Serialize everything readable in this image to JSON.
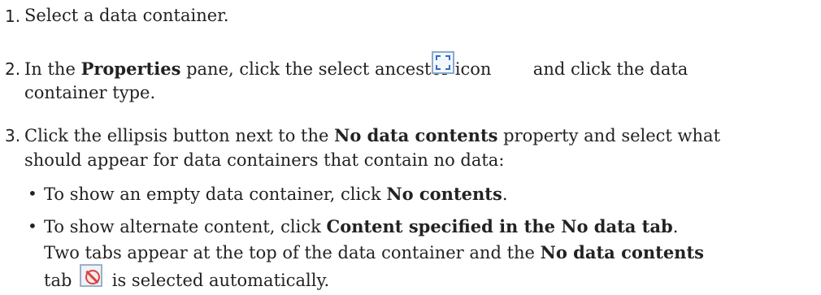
{
  "steps": [
    {
      "num": "1.",
      "lines": [
        {
          "text": "Select a data container."
        }
      ]
    },
    {
      "num": "2.",
      "line1": {
        "pre": "In the ",
        "bold": "Properties",
        "post": " pane, click the select ancestor icon ",
        "post2": " and click the data"
      },
      "line2": "container type.",
      "icon": "select-ancestor-icon"
    },
    {
      "num": "3.",
      "line1": {
        "pre": "Click the ellipsis button next to the ",
        "bold": "No data contents",
        "post": " property and select what"
      },
      "line2": "should appear for data containers that contain no data:"
    }
  ],
  "bullets": [
    {
      "pre": "To show an empty data container, click ",
      "bold": "No contents",
      "post": "."
    },
    {
      "pre": "To show alternate content, click ",
      "bold": "Content specified in the No data tab",
      "post": "."
    }
  ],
  "note": {
    "line1": {
      "pre": "Two tabs appear at the top of the data container and the ",
      "bold": "No data contents"
    },
    "line2": {
      "pre": "tab ",
      "post": " is selected automatically."
    },
    "icon": "no-data-tab-icon"
  }
}
